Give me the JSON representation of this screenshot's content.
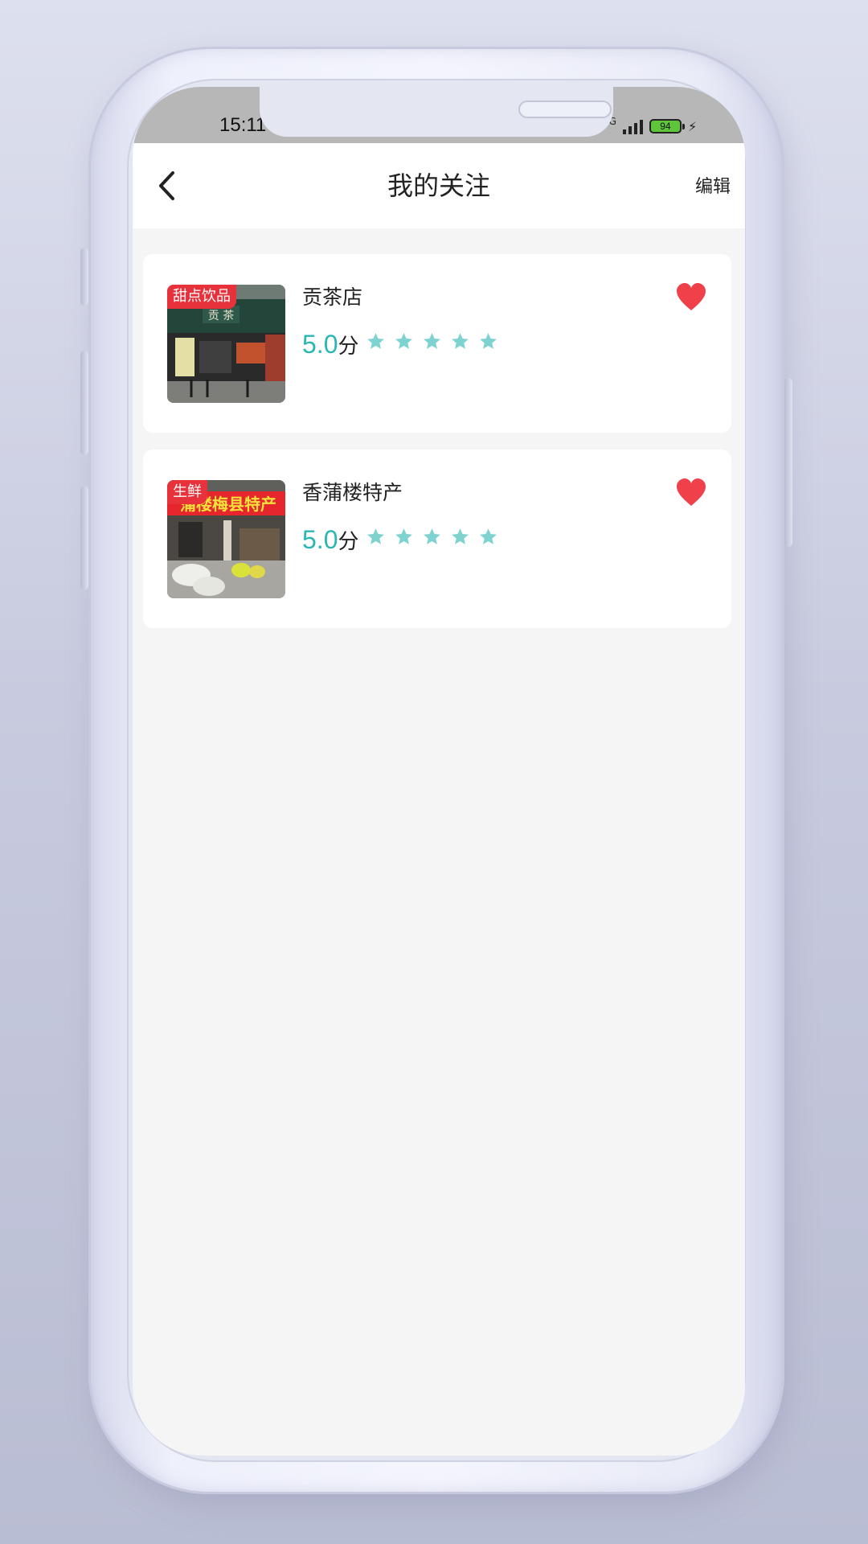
{
  "status_bar": {
    "time": "15:11",
    "network": "5G",
    "battery": "94"
  },
  "nav": {
    "title": "我的关注",
    "edit_label": "编辑"
  },
  "stores": [
    {
      "tag": "甜点饮品",
      "name": "贡茶店",
      "score": "5.0",
      "score_unit": "分",
      "stars": 5,
      "favorited": true
    },
    {
      "tag": "生鲜",
      "name": "香蒲楼特产",
      "score": "5.0",
      "score_unit": "分",
      "stars": 5,
      "favorited": true
    }
  ],
  "colors": {
    "accent": "#2ab7b3",
    "star": "#7ed3d1",
    "heart": "#f0414b",
    "tag": "#e8323b",
    "background": "#f5f5f5"
  },
  "icons": {
    "back": "chevron-left-icon",
    "favorite": "heart-icon",
    "rating": "star-icon"
  }
}
